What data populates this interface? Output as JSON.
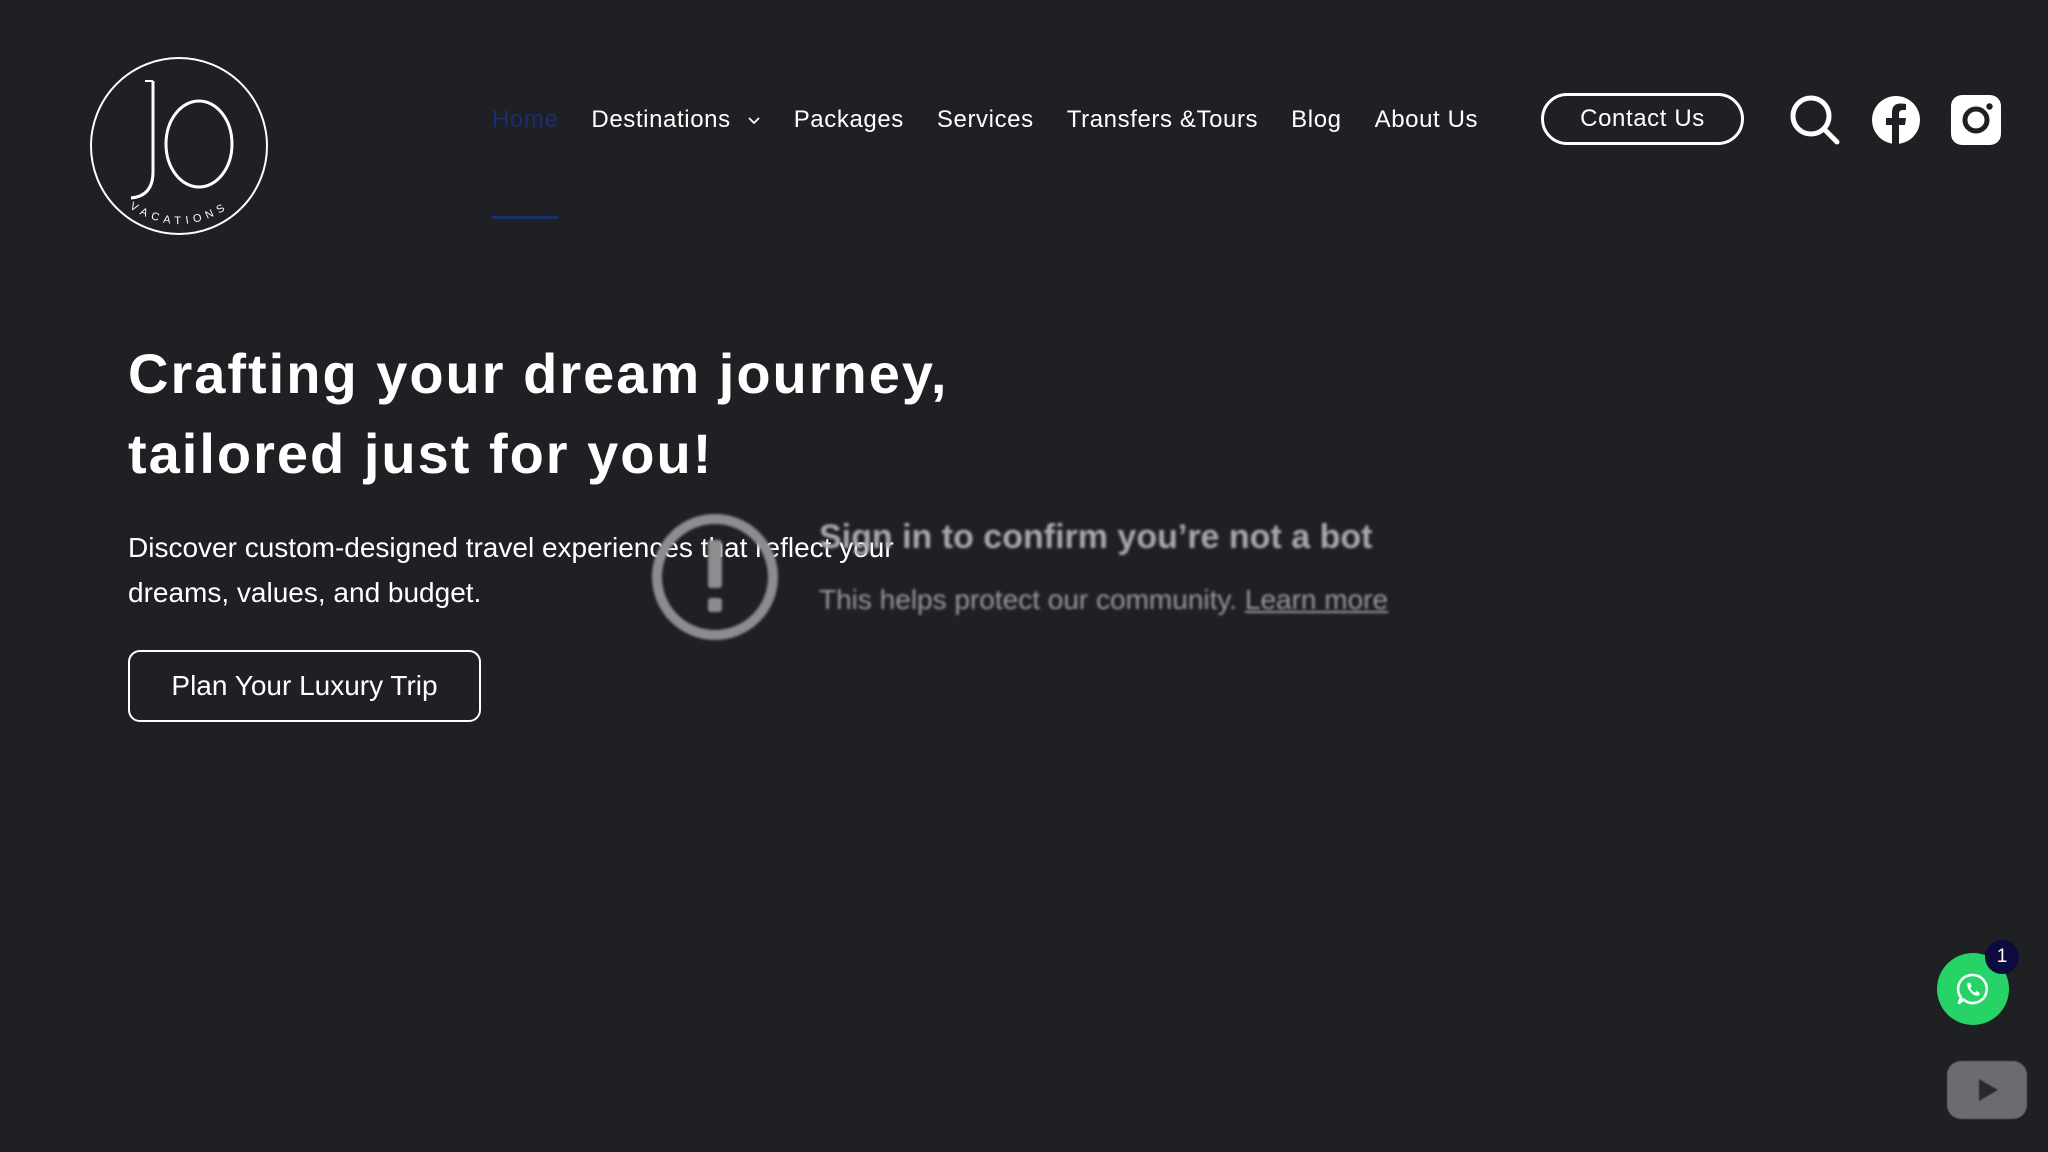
{
  "brand": {
    "logo_text": "JO",
    "logo_tagline": "VACATIONS"
  },
  "nav": {
    "items": [
      {
        "label": "Home",
        "active": true
      },
      {
        "label": "Destinations",
        "has_dropdown": true
      },
      {
        "label": "Packages"
      },
      {
        "label": "Services"
      },
      {
        "label": "Transfers &Tours"
      },
      {
        "label": "Blog"
      },
      {
        "label": "About Us"
      }
    ],
    "contact_label": "Contact Us"
  },
  "header_icons": [
    "search-icon",
    "facebook-icon",
    "instagram-icon"
  ],
  "hero": {
    "title_line1": "Crafting your dream journey,",
    "title_line2": "tailored just for you!",
    "subtitle_line1": "Discover custom-designed travel experiences that reflect your",
    "subtitle_line2": "dreams, values, and budget.",
    "cta_label": "Plan Your Luxury Trip"
  },
  "video_overlay": {
    "title": "Sign in to confirm you’re not a bot",
    "description": "This helps protect our community.",
    "link_label": "Learn more"
  },
  "widgets": {
    "whatsapp_badge_count": "1"
  },
  "colors": {
    "background": "#1f2024",
    "text": "#ffffff",
    "active_nav": "#1c2d6b",
    "whatsapp_green": "#25d366",
    "badge_navy": "#0b0b3d"
  }
}
